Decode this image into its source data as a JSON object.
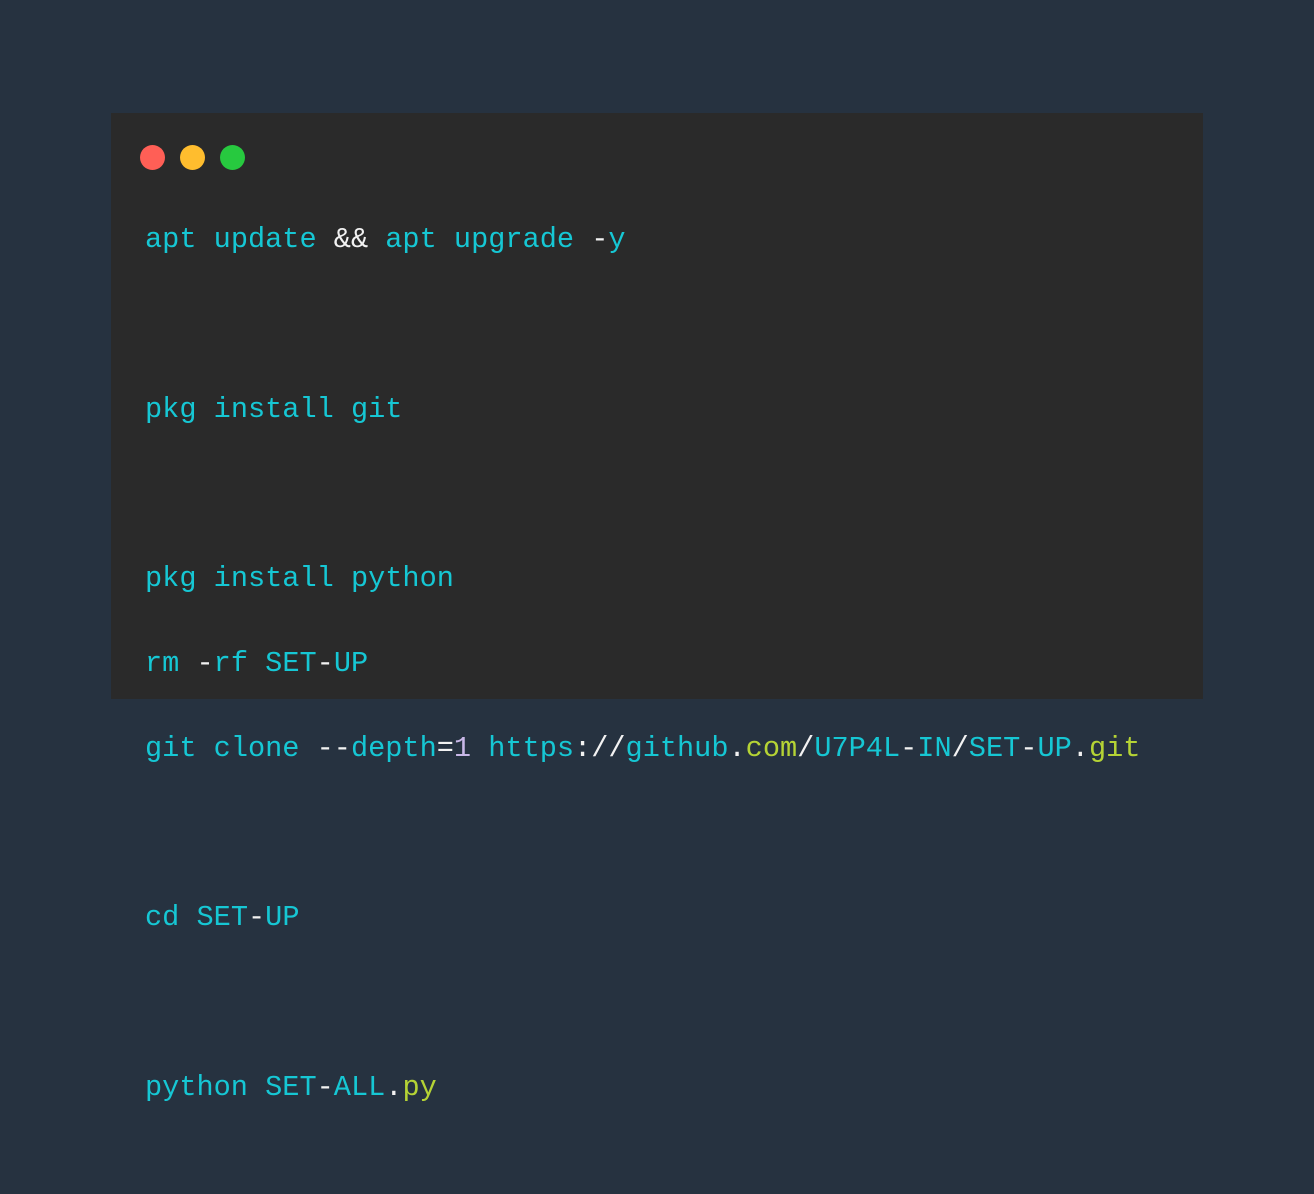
{
  "window": {
    "controls": [
      {
        "name": "close-dot",
        "color": "#ff5f56"
      },
      {
        "name": "minimize-dot",
        "color": "#ffbd2e"
      },
      {
        "name": "zoom-dot",
        "color": "#27c93f"
      }
    ]
  },
  "colors": {
    "page_background": "#263240",
    "window_background": "#2a2a2a",
    "keyword": "#16c7d4",
    "operator": "#f2f2f2",
    "number": "#c9b8e8",
    "attribute": "#b5d335"
  },
  "code": {
    "lines": [
      [
        {
          "text": "apt",
          "role": "keyword"
        },
        {
          "text": " ",
          "role": "operator"
        },
        {
          "text": "update",
          "role": "keyword"
        },
        {
          "text": " && ",
          "role": "operator"
        },
        {
          "text": "apt",
          "role": "keyword"
        },
        {
          "text": " ",
          "role": "operator"
        },
        {
          "text": "upgrade",
          "role": "keyword"
        },
        {
          "text": " -",
          "role": "operator"
        },
        {
          "text": "y",
          "role": "keyword"
        }
      ],
      [],
      [
        {
          "text": "pkg",
          "role": "keyword"
        },
        {
          "text": " ",
          "role": "operator"
        },
        {
          "text": "install",
          "role": "keyword"
        },
        {
          "text": " ",
          "role": "operator"
        },
        {
          "text": "git",
          "role": "keyword"
        }
      ],
      [],
      [
        {
          "text": "pkg",
          "role": "keyword"
        },
        {
          "text": " ",
          "role": "operator"
        },
        {
          "text": "install",
          "role": "keyword"
        },
        {
          "text": " ",
          "role": "operator"
        },
        {
          "text": "python",
          "role": "keyword"
        }
      ],
      [
        {
          "text": "rm",
          "role": "keyword"
        },
        {
          "text": " -",
          "role": "operator"
        },
        {
          "text": "rf",
          "role": "keyword"
        },
        {
          "text": " ",
          "role": "operator"
        },
        {
          "text": "SET",
          "role": "keyword"
        },
        {
          "text": "-",
          "role": "operator"
        },
        {
          "text": "UP",
          "role": "keyword"
        }
      ],
      [
        {
          "text": "git",
          "role": "keyword"
        },
        {
          "text": " ",
          "role": "operator"
        },
        {
          "text": "clone",
          "role": "keyword"
        },
        {
          "text": " --",
          "role": "operator"
        },
        {
          "text": "depth",
          "role": "keyword"
        },
        {
          "text": "=",
          "role": "operator"
        },
        {
          "text": "1",
          "role": "number"
        },
        {
          "text": " ",
          "role": "operator"
        },
        {
          "text": "https",
          "role": "keyword"
        },
        {
          "text": "://",
          "role": "operator"
        },
        {
          "text": "github",
          "role": "keyword"
        },
        {
          "text": ".",
          "role": "operator"
        },
        {
          "text": "com",
          "role": "attribute"
        },
        {
          "text": "/",
          "role": "operator"
        },
        {
          "text": "U7P4L",
          "role": "keyword"
        },
        {
          "text": "-",
          "role": "operator"
        },
        {
          "text": "IN",
          "role": "keyword"
        },
        {
          "text": "/",
          "role": "operator"
        },
        {
          "text": "SET",
          "role": "keyword"
        },
        {
          "text": "-",
          "role": "operator"
        },
        {
          "text": "UP",
          "role": "keyword"
        },
        {
          "text": ".",
          "role": "operator"
        },
        {
          "text": "git",
          "role": "attribute"
        }
      ],
      [],
      [
        {
          "text": "cd",
          "role": "keyword"
        },
        {
          "text": " ",
          "role": "operator"
        },
        {
          "text": "SET",
          "role": "keyword"
        },
        {
          "text": "-",
          "role": "operator"
        },
        {
          "text": "UP",
          "role": "keyword"
        }
      ],
      [],
      [
        {
          "text": "python",
          "role": "keyword"
        },
        {
          "text": " ",
          "role": "operator"
        },
        {
          "text": "SET",
          "role": "keyword"
        },
        {
          "text": "-",
          "role": "operator"
        },
        {
          "text": "ALL",
          "role": "keyword"
        },
        {
          "text": ".",
          "role": "operator"
        },
        {
          "text": "py",
          "role": "attribute"
        }
      ]
    ]
  }
}
